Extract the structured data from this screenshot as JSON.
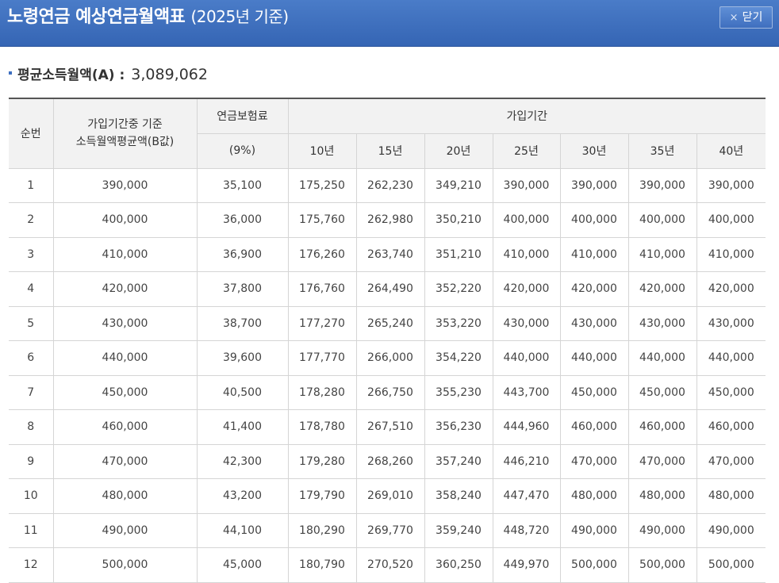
{
  "window": {
    "title": "노령연금 예상연금월액표",
    "title_suffix": "(2025년 기준)",
    "close_icon": "×",
    "close_label": "닫기"
  },
  "average": {
    "label": "평균소득월액(A) :",
    "value": "3,089,062"
  },
  "table": {
    "headers": {
      "seq": "순번",
      "base_line1": "가입기간중 기준",
      "base_line2": "소득월액평균액(B값)",
      "premium_line1": "연금보험료",
      "premium_line2": "(9%)",
      "period_group": "가입기간",
      "periods": [
        "10년",
        "15년",
        "20년",
        "25년",
        "30년",
        "35년",
        "40년"
      ]
    },
    "rows": [
      [
        "1",
        "390,000",
        "35,100",
        "175,250",
        "262,230",
        "349,210",
        "390,000",
        "390,000",
        "390,000",
        "390,000"
      ],
      [
        "2",
        "400,000",
        "36,000",
        "175,760",
        "262,980",
        "350,210",
        "400,000",
        "400,000",
        "400,000",
        "400,000"
      ],
      [
        "3",
        "410,000",
        "36,900",
        "176,260",
        "263,740",
        "351,210",
        "410,000",
        "410,000",
        "410,000",
        "410,000"
      ],
      [
        "4",
        "420,000",
        "37,800",
        "176,760",
        "264,490",
        "352,220",
        "420,000",
        "420,000",
        "420,000",
        "420,000"
      ],
      [
        "5",
        "430,000",
        "38,700",
        "177,270",
        "265,240",
        "353,220",
        "430,000",
        "430,000",
        "430,000",
        "430,000"
      ],
      [
        "6",
        "440,000",
        "39,600",
        "177,770",
        "266,000",
        "354,220",
        "440,000",
        "440,000",
        "440,000",
        "440,000"
      ],
      [
        "7",
        "450,000",
        "40,500",
        "178,280",
        "266,750",
        "355,230",
        "443,700",
        "450,000",
        "450,000",
        "450,000"
      ],
      [
        "8",
        "460,000",
        "41,400",
        "178,780",
        "267,510",
        "356,230",
        "444,960",
        "460,000",
        "460,000",
        "460,000"
      ],
      [
        "9",
        "470,000",
        "42,300",
        "179,280",
        "268,260",
        "357,240",
        "446,210",
        "470,000",
        "470,000",
        "470,000"
      ],
      [
        "10",
        "480,000",
        "43,200",
        "179,790",
        "269,010",
        "358,240",
        "447,470",
        "480,000",
        "480,000",
        "480,000"
      ],
      [
        "11",
        "490,000",
        "44,100",
        "180,290",
        "269,770",
        "359,240",
        "448,720",
        "490,000",
        "490,000",
        "490,000"
      ],
      [
        "12",
        "500,000",
        "45,000",
        "180,790",
        "270,520",
        "360,250",
        "449,970",
        "500,000",
        "500,000",
        "500,000"
      ]
    ]
  },
  "colors": {
    "titlebar": "#3d6fc0",
    "header_bg": "#f2f2f2",
    "border": "#d5d5d5"
  }
}
